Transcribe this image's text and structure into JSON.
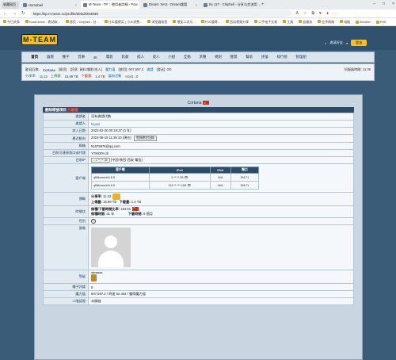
{
  "browser": {
    "pinned_tab": "收藏网页",
    "tabs": [
      {
        "label": "Hornebail"
      },
      {
        "label": "M-Team - TP :: 使用者詳細 - Pow"
      },
      {
        "label": "Dream :NAS - Dream論壇"
      },
      {
        "label": "Ex 127 - Chiphell - 分享与交流用"
      }
    ],
    "url": "https://kp.m-team.cc/profile/detail/264635",
    "bookmarks": [
      "今日头条",
      "KoolCenter - 跑动软...",
      "首页 - Chiphell - 分...",
      "什么值得买 | 小众消费...",
      "浏览器标签",
      "港女二次元...",
      "什么值得...",
      "西瓜视频分享",
      "二手电子交易",
      "工具",
      "云服务",
      "业余网络",
      "电脑",
      "Zerotier",
      "PVE"
    ]
  },
  "header": {
    "logo_text": "M-TEAM",
    "invite_label": "邀请好友",
    "signout_label": "登出"
  },
  "nav": [
    {
      "label": "首页"
    },
    {
      "label": "論壇"
    },
    {
      "label": "種子"
    },
    {
      "label": "音樂"
    },
    {
      "label": "4K"
    },
    {
      "label": "電影"
    },
    {
      "label": "影劇"
    },
    {
      "label": "成人"
    },
    {
      "label": "成人"
    },
    {
      "label": "小組"
    },
    {
      "label": "互動"
    },
    {
      "label": "求種"
    },
    {
      "label": "規則"
    },
    {
      "label": "獲獎"
    },
    {
      "label": "幫助"
    },
    {
      "label": "評論"
    },
    {
      "label": "排行榜"
    },
    {
      "label": "管理組"
    }
  ],
  "userbar": {
    "welcome": "歡迎回來,",
    "username": "Cortana",
    "rank": "[資訊]",
    "tags": "[訊息: 資料/電影/成人]",
    "magic_label": "魔力值",
    "magic_value": "[使用]: 607,597.2",
    "invite_text": "邀請",
    "invite_count": "[發送]: 0/0",
    "share_ratio_label": "分享率:",
    "share_ratio": "11.22",
    "upload_label": "上傳量:",
    "upload": "15.69 TB",
    "download_label": "下載量:",
    "download": "1.4 TB",
    "seeding_label": "當前活動",
    "seeding": "↑4141 ↓0",
    "server_time_label": "伺服器時間:",
    "server_time": "11:36"
  },
  "profile": {
    "name": "Cortana",
    "section_header": "劃除帳號項目",
    "section_status": "已驗證",
    "rows": {
      "inviter_label": "邀請者",
      "inviter_value": "沒有邀請代數",
      "invited_label": "邀請人",
      "invited_value": "bigspt",
      "join_label": "加入日期",
      "join_value": "2022-02-20 00:19:37 (3 年)",
      "last_label": "最近動向",
      "last_value": "2024-09-15 11:35:10 (現在)",
      "history_button": "登錄歷史記錄",
      "email_label": "郵箱",
      "email_value": "51878878@qq.com",
      "ipv6_label": "目前可連接漁口或代理",
      "ipv6_value": "YTMOPA.tlr",
      "ip_label": "目前IP",
      "ip_value": "• 1.**.**.36",
      "ip_location": "[中国-陕西-西安 電信]",
      "client_label": "客戶端",
      "client_headers": [
        "客戶端",
        "IPv4",
        "IPv6",
        "端口"
      ],
      "clients": [
        {
          "name": "qBittorrent/4.6.5",
          "ipv4": "1.**.**.36",
          "ipv6": "N/A",
          "port": "39171"
        },
        {
          "name": "qBittorrent/4.6.5",
          "ipv4": "113.**.***.159",
          "ipv6": "N/A",
          "port": "39171"
        }
      ],
      "traffic_label": "傳輸",
      "share_ratio_label": "分享率:",
      "share_ratio": "11.22",
      "upload_label": "上傳量:",
      "upload": "15.69 TB",
      "download_label": "下載量:",
      "download": "1.4 TB",
      "time_label": "時間比",
      "time_ratio_label": "做種/下載時間比率:",
      "time_ratio": "184.61",
      "seed_time_label": "做種時間:",
      "seed_time": "31 年",
      "dl_time_label": "下載時間:",
      "dl_time": "6 個月",
      "gender_label": "性別",
      "avatar_label": "頭像",
      "class_label": "等級",
      "class_value": "VETERAN",
      "torrents_label": "種子評論",
      "torrents_value": "5",
      "bonus_label": "魔力值",
      "bonus_value": "607,597.2 / 時速 52.454 / 獲得魔力值",
      "offer_label": "二階認證",
      "offer_value": "未開啟"
    }
  }
}
